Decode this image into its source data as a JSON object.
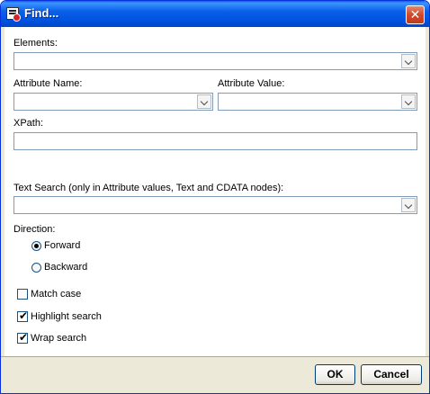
{
  "window": {
    "title": "Find...",
    "close_glyph": "✕"
  },
  "form": {
    "elements": {
      "label": "Elements:",
      "value": ""
    },
    "attribute_name": {
      "label": "Attribute Name:",
      "value": ""
    },
    "attribute_value": {
      "label": "Attribute Value:",
      "value": ""
    },
    "xpath": {
      "label": "XPath:",
      "value": ""
    },
    "text_search": {
      "label": "Text Search (only in Attribute values, Text and CDATA nodes):",
      "value": ""
    },
    "direction": {
      "label": "Direction:",
      "options": [
        {
          "label": "Forward",
          "selected": true
        },
        {
          "label": "Backward",
          "selected": false
        }
      ]
    },
    "checkboxes": [
      {
        "label": "Match case",
        "checked": false
      },
      {
        "label": "Highlight search",
        "checked": true
      },
      {
        "label": "Wrap search",
        "checked": true
      }
    ]
  },
  "buttons": {
    "ok": "OK",
    "cancel": "Cancel"
  },
  "icons": {
    "title": "find-dialog-icon",
    "dropdown": "chevron-down-icon",
    "check": "✔"
  }
}
